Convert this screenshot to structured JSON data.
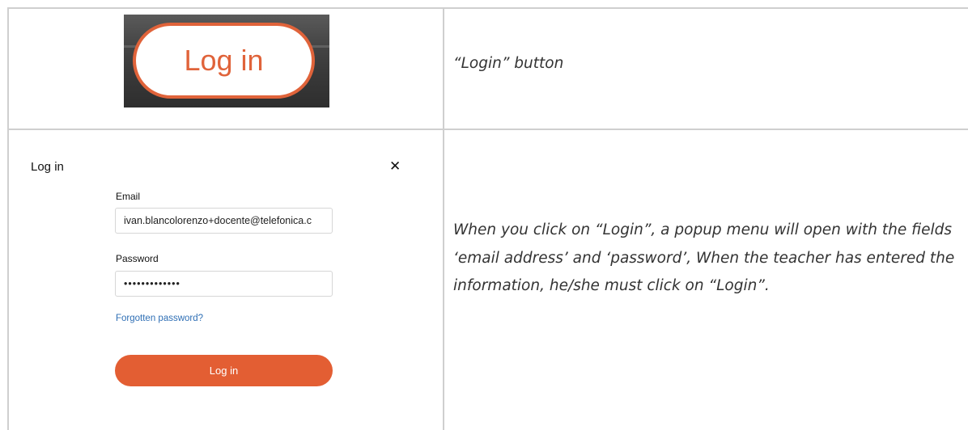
{
  "row1": {
    "photo_button_label": "Log in",
    "caption": "“Login” button"
  },
  "row2": {
    "modal": {
      "title": "Log in",
      "close_icon": "close-icon",
      "email_label": "Email",
      "email_value": "ivan.blancolorenzo+docente@telefonica.c",
      "password_label": "Password",
      "password_value": "•••••••••••••",
      "forgot_link": "Forgotten password?",
      "login_button": "Log in"
    },
    "caption": "When you click on “Login”, a popup menu will open with the fields ‘email address’ and ‘password’, When the teacher has entered the information, he/she must click on “Login”."
  },
  "colors": {
    "accent": "#e35e33",
    "link": "#2f6fb5",
    "border": "#cfcfcf"
  }
}
